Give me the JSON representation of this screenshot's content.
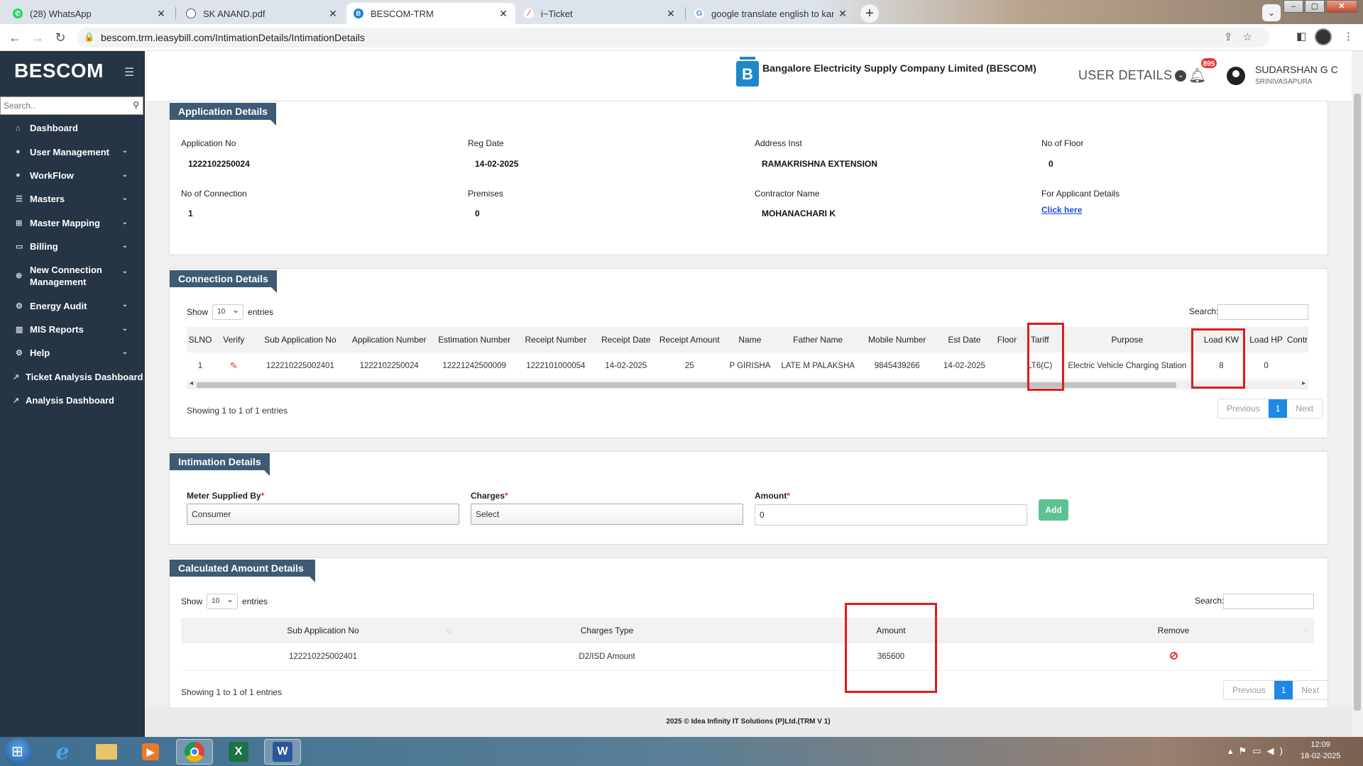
{
  "browser": {
    "tabs": [
      {
        "label": "(28) WhatsApp",
        "icon": "whatsapp-icon"
      },
      {
        "label": "SK ANAND.pdf",
        "icon": "globe-icon"
      },
      {
        "label": "BESCOM-TRM",
        "icon": "bescom-icon"
      },
      {
        "label": "i~Ticket",
        "icon": "ticket-icon"
      },
      {
        "label": "google translate english to kann",
        "icon": "google-icon"
      }
    ],
    "url": "bescom.trm.ieasybill.com/IntimationDetails/IntimationDetails"
  },
  "sidebar": {
    "brand": "BESCOM",
    "search_placeholder": "Search..",
    "items": [
      {
        "label": "Dashboard"
      },
      {
        "label": "User Management"
      },
      {
        "label": "WorkFlow"
      },
      {
        "label": "Masters"
      },
      {
        "label": "Master Mapping"
      },
      {
        "label": "Billing"
      },
      {
        "label": "New Connection Management"
      },
      {
        "label": "Energy Audit"
      },
      {
        "label": "MIS Reports"
      },
      {
        "label": "Help"
      },
      {
        "label": "Ticket Analysis Dashboard"
      },
      {
        "label": "Analysis Dashboard"
      }
    ]
  },
  "header": {
    "company": "Bangalore Electricity Supply Company Limited (BESCOM)",
    "user_details": "USER DETAILS",
    "notifications": "895",
    "user_name": "SUDARSHAN G C",
    "user_location": "SRINIVASAPURA"
  },
  "application": {
    "title": "Application Details",
    "fields": [
      {
        "label": "Application No",
        "value": "1222102250024"
      },
      {
        "label": "Reg Date",
        "value": "14-02-2025"
      },
      {
        "label": "Address Inst",
        "value": "RAMAKRISHNA EXTENSION"
      },
      {
        "label": "No of Floor",
        "value": "0"
      },
      {
        "label": "No of Connection",
        "value": "1"
      },
      {
        "label": "Premises",
        "value": "0"
      },
      {
        "label": "Contractor Name",
        "value": "MOHANACHARI K"
      },
      {
        "label": "For Applicant Details",
        "value": "Click here"
      }
    ]
  },
  "connection": {
    "title": "Connection Details",
    "show": "Show",
    "entries_value": "10",
    "entries": "entries",
    "search": "Search:",
    "columns": [
      "SLNO",
      "Verify",
      "Sub Application No",
      "Application Number",
      "Estimation Number",
      "Receipt Number",
      "Receipt Date",
      "Receipt Amount",
      "Name",
      "Father Name",
      "Mobile Number",
      "Est Date",
      "Floor",
      "Tariff",
      "Purpose",
      "Load KW",
      "Load HP",
      "Contr"
    ],
    "row": [
      "1",
      "",
      "122210225002401",
      "1222102250024",
      "12221242500009",
      "1222101000054",
      "14-02-2025",
      "25",
      "P GIRISHA",
      "LATE M PALAKSHA",
      "9845439266",
      "14-02-2025",
      "",
      "LT6(C)",
      "Electric Vehicle Charging Station",
      "8",
      "0",
      ""
    ],
    "info": "Showing 1 to 1 of 1 entries",
    "prev": "Previous",
    "page": "1",
    "next": "Next"
  },
  "intimation": {
    "title": "Intimation Details",
    "meter_label": "Meter Supplied By",
    "meter_value": "Consumer",
    "charges_label": "Charges",
    "charges_value": "Select",
    "amount_label": "Amount",
    "amount_value": "0",
    "add": "Add",
    "required_mark": "*"
  },
  "calculated": {
    "title": "Calculated Amount Details",
    "show": "Show",
    "entries_value": "10",
    "entries": "entries",
    "search": "Search:",
    "columns": [
      "Sub Application No",
      "Charges Type",
      "Amount",
      "Remove"
    ],
    "row": {
      "sub_app": "122210225002401",
      "type": "D2/ISD Amount",
      "amount": "365600"
    },
    "info": "Showing 1 to 1 of 1 entries",
    "prev": "Previous",
    "page": "1",
    "next": "Next"
  },
  "footer": "2025 © Idea Infinity IT Solutions (P)Ltd.(TRM V 1)",
  "taskbar": {
    "time": "12:09",
    "date": "18-02-2025"
  },
  "colors": {
    "sidebar": "#253544",
    "panel_title": "#3d5b74",
    "highlight": "#e01b1b",
    "add_button": "#5cc290",
    "pager_active": "#1e88e5"
  }
}
